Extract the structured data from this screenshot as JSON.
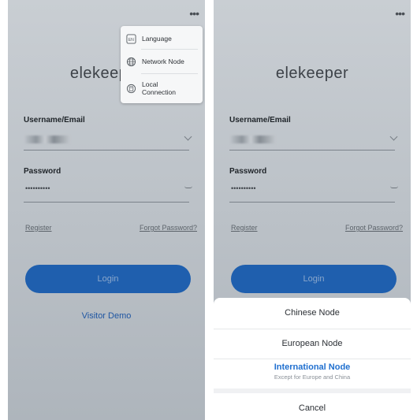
{
  "left": {
    "more_icon": "ellipsis-icon",
    "logo": "elekeeper",
    "username_label": "Username/Email",
    "password_label": "Password",
    "password_dots": "••••••••••",
    "register": "Register",
    "forgot": "Forgot Password?",
    "login": "Login",
    "visitor_demo": "Visitor Demo",
    "menu": {
      "items": [
        {
          "label": "Language",
          "icon": "language-icon"
        },
        {
          "label": "Network Node",
          "icon": "globe-icon"
        },
        {
          "label": "Local Connection",
          "line1": "Local",
          "line2": "Connection",
          "icon": "local-connection-icon"
        }
      ]
    }
  },
  "right": {
    "more_icon": "ellipsis-icon",
    "logo": "elekeeper",
    "username_label": "Username/Email",
    "password_label": "Password",
    "password_dots": "••••••••••",
    "register": "Register",
    "forgot": "Forgot Password?",
    "login": "Login",
    "sheet": {
      "chinese": "Chinese Node",
      "european": "European Node",
      "international": "International Node",
      "international_sub": "Except for Europe and China",
      "cancel": "Cancel"
    }
  },
  "colors": {
    "accent": "#1f5fae",
    "selected": "#1f6fcf",
    "link_blue": "#1f56a2"
  }
}
